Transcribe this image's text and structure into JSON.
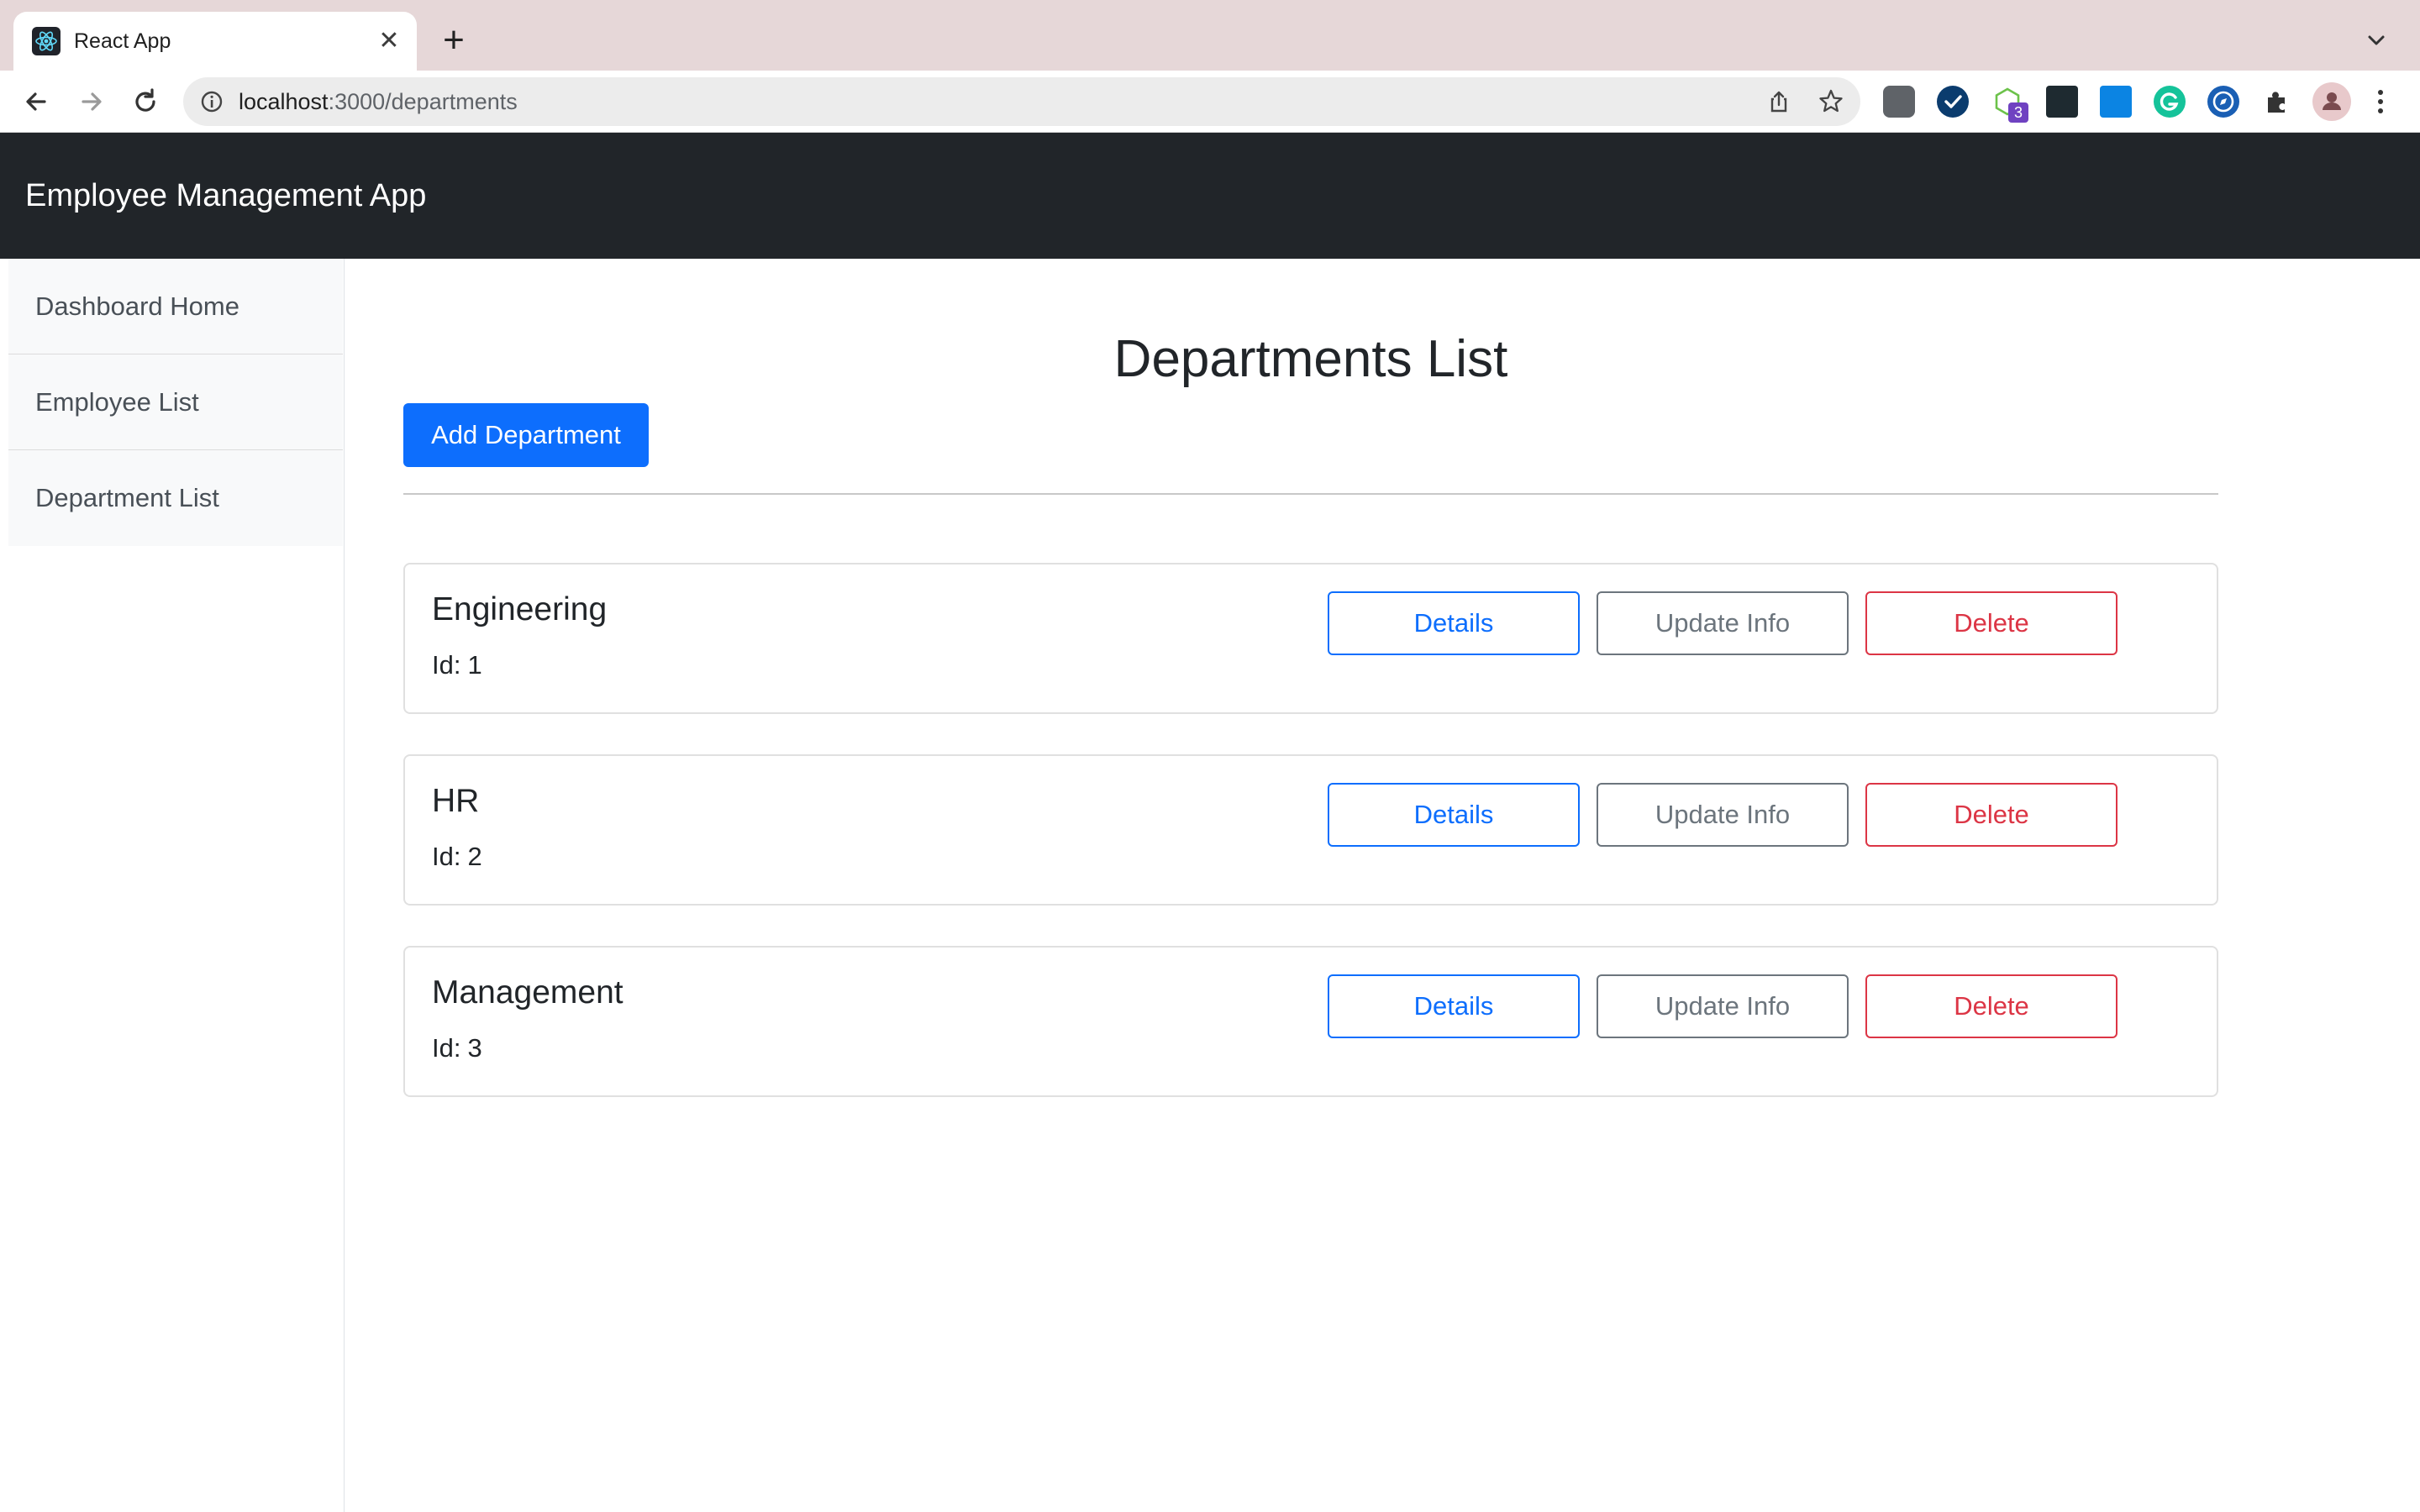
{
  "browser": {
    "tab_title": "React App",
    "close_glyph": "✕",
    "newtab_glyph": "+",
    "url_host": "localhost",
    "url_path": ":3000/departments",
    "extension_badge": "3",
    "colors": {
      "tabstrip": "#e6d7d8",
      "omnibox": "#ececec"
    }
  },
  "app": {
    "brand": "Employee Management App",
    "colors": {
      "navbar": "#212529",
      "primary": "#0d6efd",
      "secondary": "#6c757d",
      "danger": "#dc3545"
    }
  },
  "sidebar": {
    "items": [
      {
        "label": "Dashboard Home"
      },
      {
        "label": "Employee List"
      },
      {
        "label": "Department List"
      }
    ]
  },
  "main": {
    "title": "Departments List",
    "add_button": "Add Department",
    "id_label": "Id:",
    "details_label": "Details",
    "update_label": "Update Info",
    "delete_label": "Delete",
    "departments": [
      {
        "name": "Engineering",
        "id": "1"
      },
      {
        "name": "HR",
        "id": "2"
      },
      {
        "name": "Management",
        "id": "3"
      }
    ]
  }
}
